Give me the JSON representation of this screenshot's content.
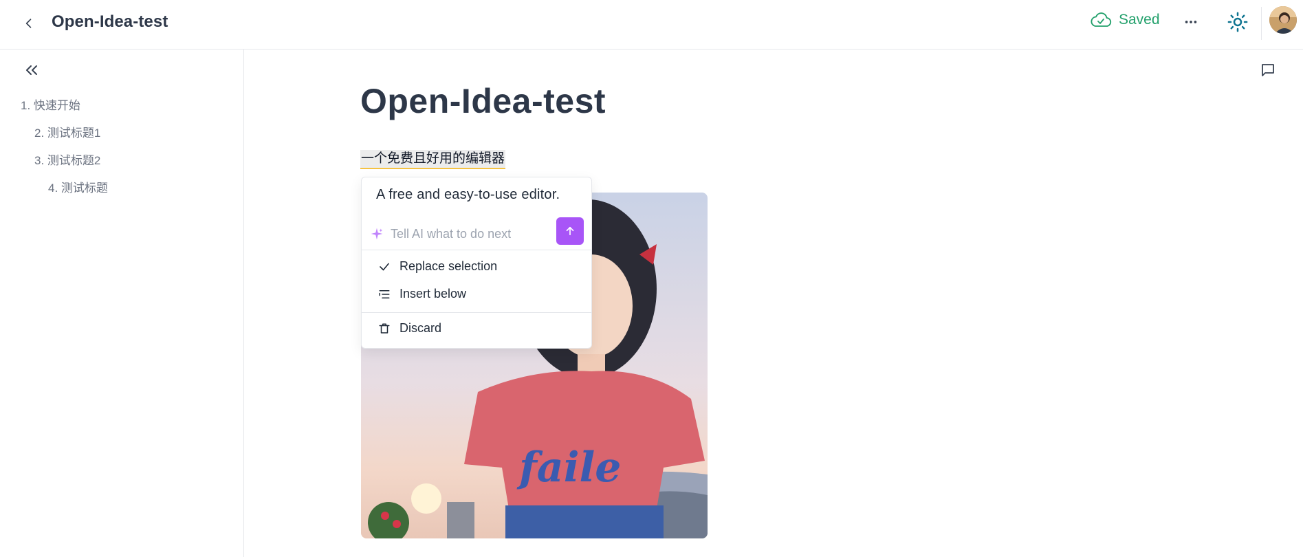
{
  "header": {
    "title": "Open-Idea-test",
    "save_status": "Saved",
    "colors": {
      "saved": "#22a06b",
      "theme_icon": "#0e7490"
    },
    "icons": [
      "chevron-left-icon",
      "cloud-check-icon",
      "more-horizontal-icon",
      "sun-icon"
    ]
  },
  "sidebar": {
    "collapse_icon": "chevrons-left-icon",
    "toc": [
      {
        "label": "1. 快速开始"
      },
      {
        "label": "2. 测试标题1"
      },
      {
        "label": "3. 测试标题2"
      },
      {
        "label": "4. 测试标题"
      }
    ]
  },
  "main": {
    "heading": "Open-Idea-test",
    "paragraph": "一个免费且好用的编辑器",
    "comment_icon": "message-square-icon",
    "image_icon": "illustration"
  },
  "ai_popup": {
    "result": "A free and easy-to-use editor.",
    "input_placeholder": "Tell AI what to do next",
    "input_value": "",
    "accent": "#a855f7",
    "actions": [
      {
        "label": "Replace selection",
        "icon": "check-icon"
      },
      {
        "label": "Insert below",
        "icon": "text-indent-icon"
      },
      {
        "label": "Discard",
        "icon": "trash-icon"
      }
    ]
  }
}
